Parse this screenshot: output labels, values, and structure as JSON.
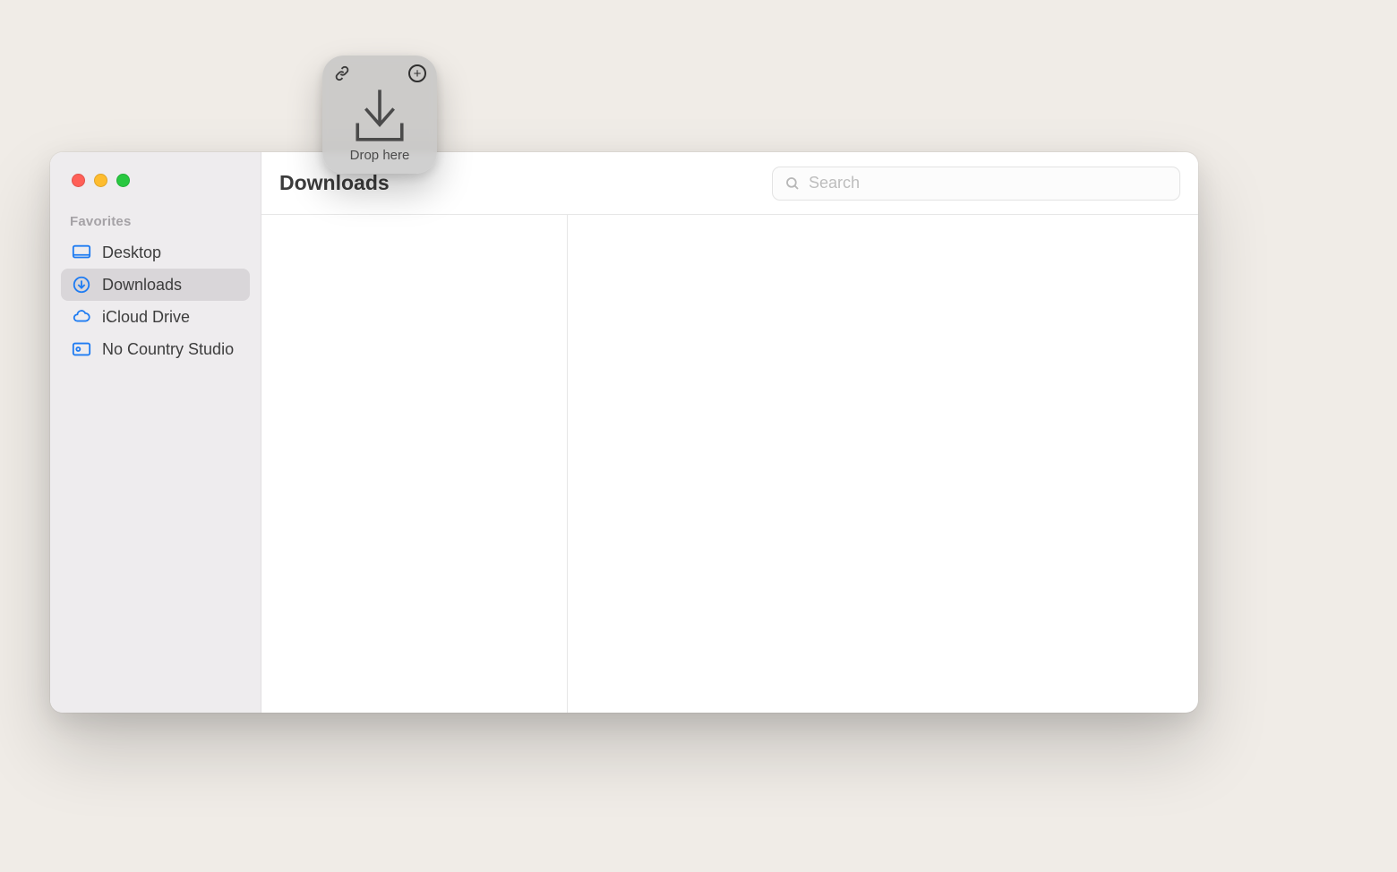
{
  "window": {
    "title": "Downloads"
  },
  "sidebar": {
    "section": "Favorites",
    "items": [
      {
        "label": "Desktop"
      },
      {
        "label": "Downloads"
      },
      {
        "label": "iCloud Drive"
      },
      {
        "label": "No Country Studio"
      }
    ]
  },
  "search": {
    "placeholder": "Search"
  },
  "dropzone": {
    "label": "Drop here"
  }
}
